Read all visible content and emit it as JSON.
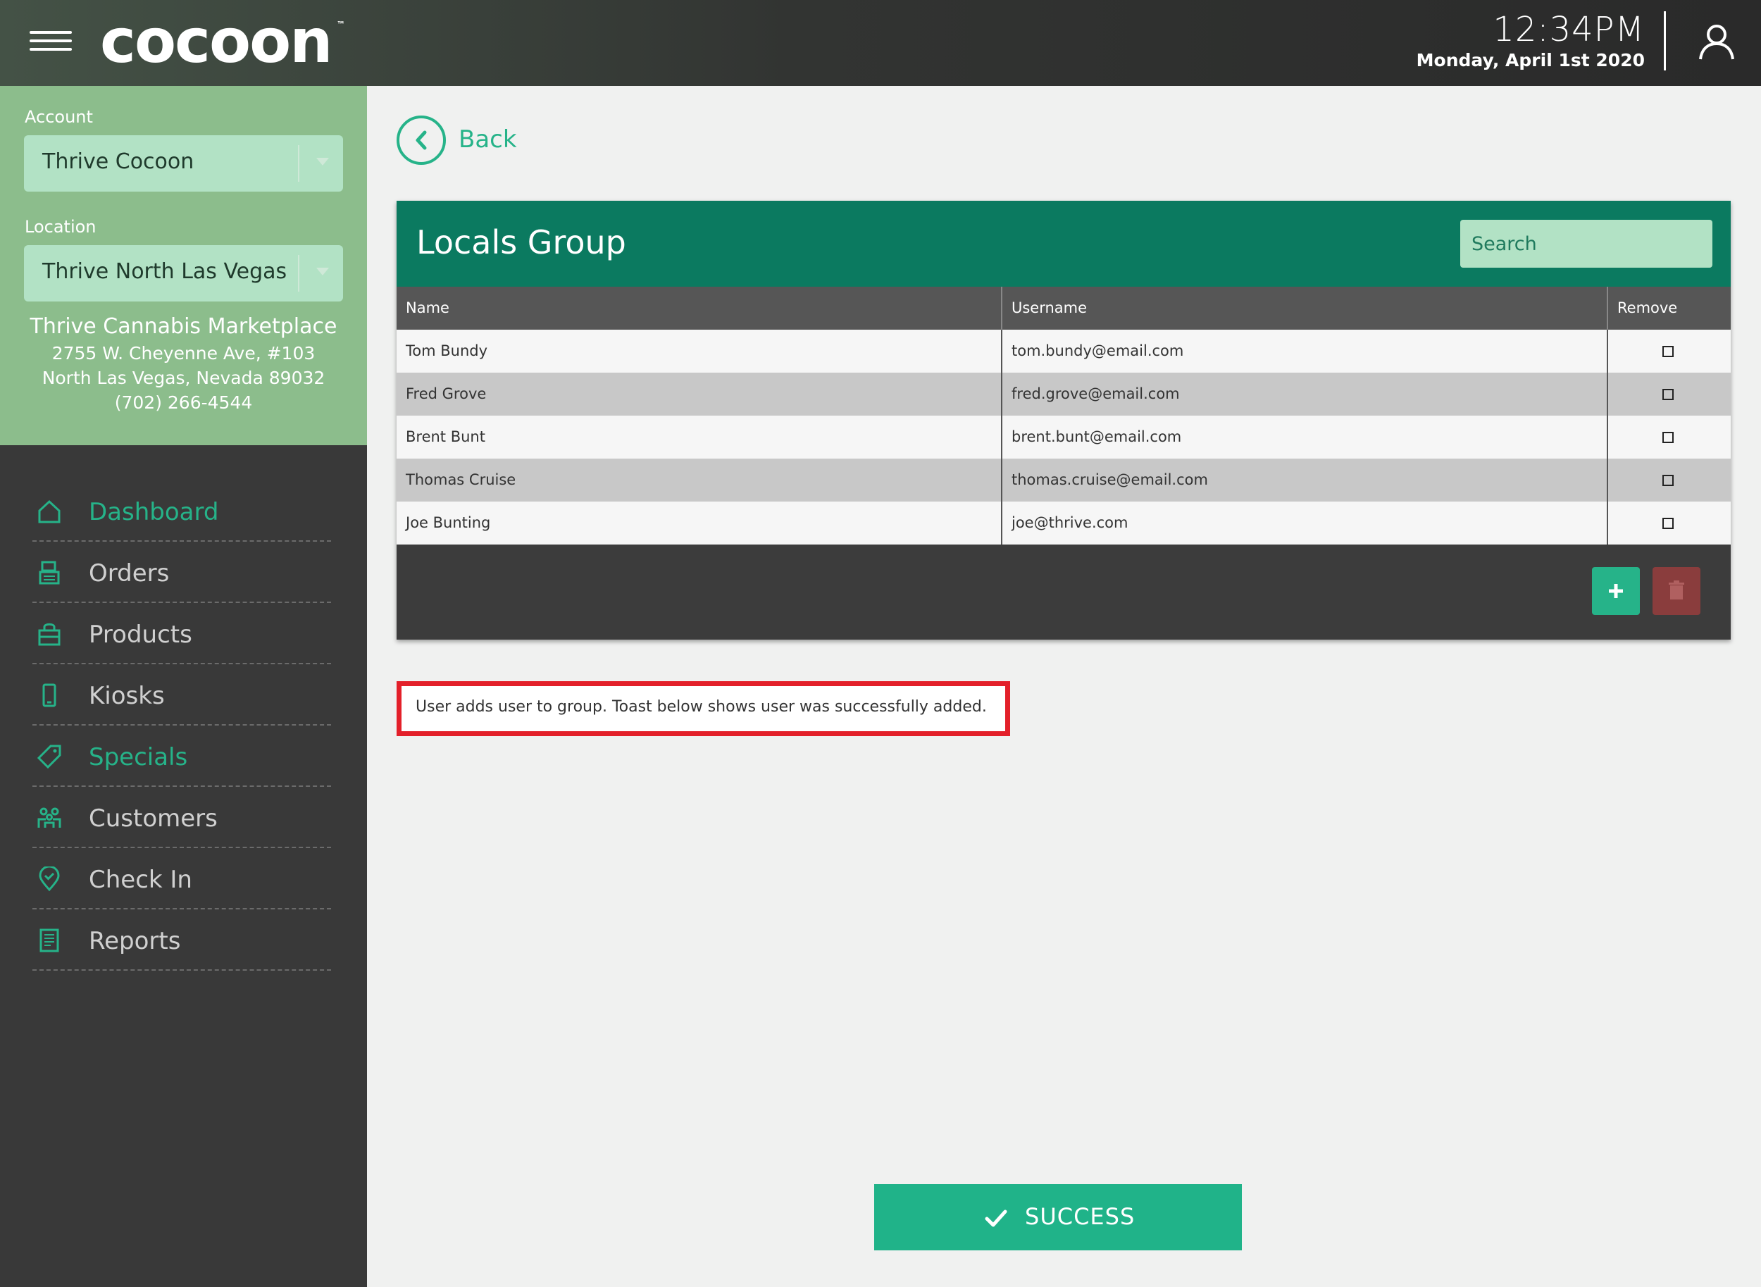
{
  "header": {
    "logo_text": "cocoon",
    "logo_tm": "™",
    "time": "12:34PM",
    "date": "Monday, April 1st 2020"
  },
  "sidebar": {
    "account_label": "Account",
    "account_value": "Thrive Cocoon",
    "location_label": "Location",
    "location_value": "Thrive North Las Vegas",
    "store_name": "Thrive Cannabis Marketplace",
    "address_line1": "2755 W. Cheyenne Ave, #103",
    "address_line2": "North Las Vegas, Nevada 89032",
    "phone": "(702) 266-4544",
    "nav": [
      {
        "label": "Dashboard",
        "icon": "home-icon",
        "active": true
      },
      {
        "label": "Orders",
        "icon": "register-icon",
        "active": false
      },
      {
        "label": "Products",
        "icon": "bag-icon",
        "active": false
      },
      {
        "label": "Kiosks",
        "icon": "kiosk-icon",
        "active": false
      },
      {
        "label": "Specials",
        "icon": "tag-icon",
        "active": true
      },
      {
        "label": "Customers",
        "icon": "customers-icon",
        "active": false
      },
      {
        "label": "Check In",
        "icon": "location-check-icon",
        "active": false
      },
      {
        "label": "Reports",
        "icon": "report-icon",
        "active": false
      }
    ]
  },
  "main": {
    "back_label": "Back",
    "group_title": "Locals Group",
    "search_placeholder": "Search",
    "columns": [
      "Name",
      "Username",
      "Remove"
    ],
    "rows": [
      {
        "name": "Tom Bundy",
        "username": "tom.bundy@email.com"
      },
      {
        "name": "Fred Grove",
        "username": "fred.grove@email.com"
      },
      {
        "name": "Brent Bunt",
        "username": "brent.bunt@email.com"
      },
      {
        "name": "Thomas Cruise",
        "username": "thomas.cruise@email.com"
      },
      {
        "name": "Joe Bunting",
        "username": "joe@thrive.com"
      }
    ],
    "annotation": "User adds user to group. Toast below shows user was successfully added.",
    "toast_label": "SUCCESS"
  },
  "colors": {
    "accent": "#26b389",
    "header_teal": "#0b7a60",
    "sidebar_green": "#8cbd8c",
    "select_mint": "#b2e2c5",
    "danger": "#8a3d3d",
    "annotation_border": "#e3202a"
  }
}
